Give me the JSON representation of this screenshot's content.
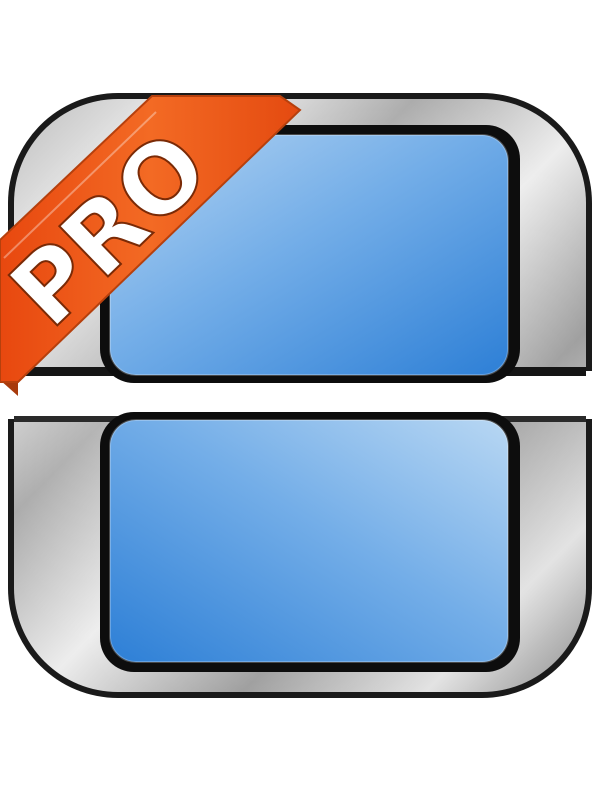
{
  "badge": {
    "label": "PRO"
  },
  "colors": {
    "background": "#ffffff",
    "metal_light": "#f4f4f4",
    "metal_dark": "#8a8a8a",
    "screen_light": "#a9cdf0",
    "screen_dark": "#2e80d8",
    "ribbon": "#f05a18",
    "ribbon_dark": "#a83a0c",
    "outline": "#111111",
    "hinge_gap": "#ffffff"
  },
  "icons": {
    "device": "dual-screen-console-icon",
    "top_screen": "top-screen",
    "bottom_screen": "bottom-screen",
    "ribbon": "pro-ribbon-badge"
  }
}
